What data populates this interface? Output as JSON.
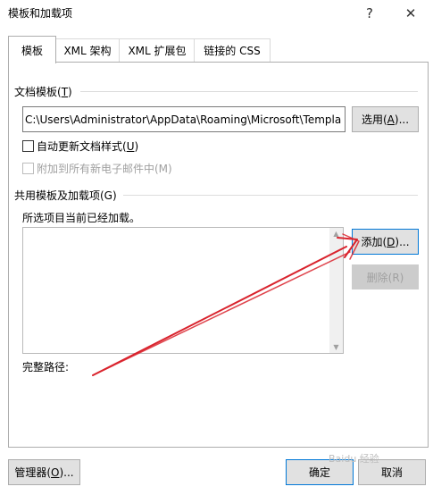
{
  "window": {
    "title": "模板和加载项",
    "help_label": "?",
    "close_label": "✕"
  },
  "tabs": [
    {
      "label": "模板",
      "active": true
    },
    {
      "label": "XML 架构",
      "active": false
    },
    {
      "label": "XML 扩展包",
      "active": false
    },
    {
      "label": "链接的 CSS",
      "active": false
    }
  ],
  "document_template": {
    "label": "文档模板(",
    "label_key": "T",
    "label_end": ")",
    "path_value": "C:\\Users\\Administrator\\AppData\\Roaming\\Microsoft\\Templa",
    "select_button": {
      "text": "选用(",
      "key": "A",
      "end": ")..."
    }
  },
  "auto_update": {
    "label": "自动更新文档样式(",
    "key": "U",
    "end": ")",
    "checked": false
  },
  "attach_email": {
    "label": "附加到所有新电子邮件中(M)",
    "checked": false,
    "disabled": true
  },
  "global_templates": {
    "label": "共用模板及加载项(G)",
    "status_text": "所选项目当前已经加载。",
    "add_button": {
      "text": "添加(",
      "key": "D",
      "end": ")..."
    },
    "remove_button": "删除(R)",
    "items": []
  },
  "full_path_label": "完整路径:",
  "footer": {
    "organizer_button": {
      "text": "管理器(",
      "key": "O",
      "end": ")..."
    },
    "ok_button": "确定",
    "cancel_button": "取消"
  },
  "annotation": {
    "color": "#d9232d"
  },
  "watermark": "Baidu 经验"
}
